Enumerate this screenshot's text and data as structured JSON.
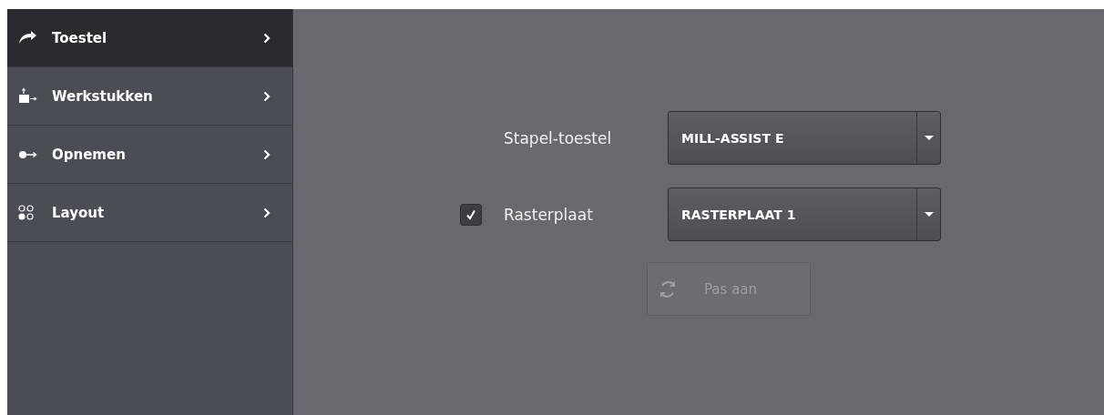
{
  "sidebar": {
    "items": [
      {
        "label": "Toestel",
        "selected": true
      },
      {
        "label": "Werkstukken",
        "selected": false
      },
      {
        "label": "Opnemen",
        "selected": false
      },
      {
        "label": "Layout",
        "selected": false
      }
    ]
  },
  "form": {
    "rows": [
      {
        "label": "Stapel-toestel",
        "value": "MILL-ASSIST E"
      },
      {
        "label": "Rasterplaat",
        "value": "RASTERPLAAT 1",
        "checked": true
      }
    ],
    "button": {
      "label": "Pas aan",
      "disabled": true
    }
  }
}
